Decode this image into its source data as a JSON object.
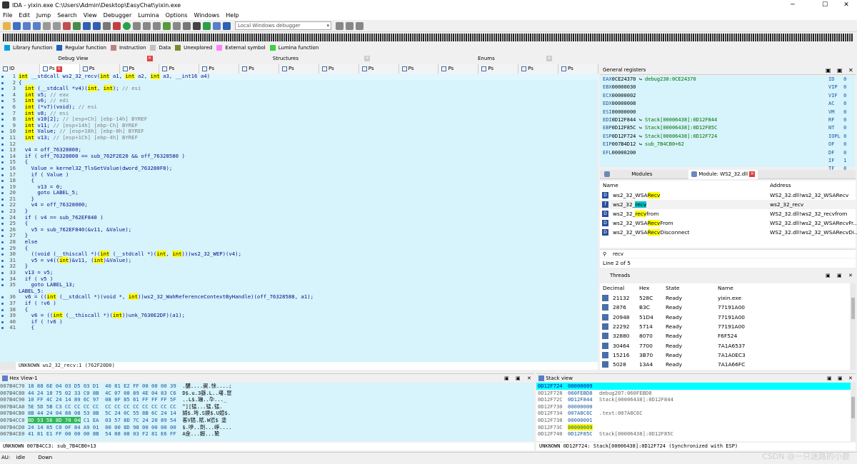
{
  "window": {
    "title": "IDA - yixin.exe C:\\Users\\Admin\\Desktop\\EasyChat\\yixin.exe"
  },
  "menu": [
    "File",
    "Edit",
    "Jump",
    "Search",
    "View",
    "Debugger",
    "Lumina",
    "Options",
    "Windows",
    "Help"
  ],
  "toolbar": {
    "debugger": "Local Windows debugger"
  },
  "legend": [
    {
      "label": "Library function",
      "color": "#00a0e0"
    },
    {
      "label": "Regular function",
      "color": "#2060c0"
    },
    {
      "label": "Instruction",
      "color": "#c08080"
    },
    {
      "label": "Data",
      "color": "#c0c0c0"
    },
    {
      "label": "Unexplored",
      "color": "#7a8a30"
    },
    {
      "label": "External symbol",
      "color": "#ff80ff"
    },
    {
      "label": "Lumina function",
      "color": "#40d040"
    }
  ],
  "top_tabs": {
    "debug_view": "Debug View",
    "structures": "Structures",
    "enums": "Enums"
  },
  "sub_tabs": {
    "first": "ID",
    "active": "Ps",
    "rest": [
      "Ps",
      "Ps",
      "Ps",
      "Ps",
      "Ps",
      "Ps",
      "Ps",
      "Ps",
      "Ps",
      "Ps",
      "Ps",
      "Ps",
      "Ps"
    ]
  },
  "pseudocode": [
    {
      "n": "1",
      "t": "int __stdcall ws2_32_recv(int a1, int a2, int a3, __int16 a4)"
    },
    {
      "n": "2",
      "t": "{"
    },
    {
      "n": "3",
      "t": "  int (__stdcall *v4)(int, int); // esi"
    },
    {
      "n": "4",
      "t": "  int v5; // eax"
    },
    {
      "n": "5",
      "t": "  int v6; // edi"
    },
    {
      "n": "6",
      "t": "  int (*v7)(void); // esi"
    },
    {
      "n": "7",
      "t": "  int v8; // esi"
    },
    {
      "n": "8",
      "t": "  int v10[2]; // [esp+Ch] [ebp-14h] BYREF"
    },
    {
      "n": "9",
      "t": "  int v11; // [esp+14h] [ebp-Ch] BYREF"
    },
    {
      "n": "10",
      "t": "  int Value; // [esp+18h] [ebp-8h] BYREF"
    },
    {
      "n": "11",
      "t": "  int v13; // [esp+1Ch] [ebp-4h] BYREF"
    },
    {
      "n": "12",
      "t": ""
    },
    {
      "n": "13",
      "t": "  v4 = off_76328000;"
    },
    {
      "n": "14",
      "t": "  if ( off_76328000 == sub_762F2E20 && off_76328580 )"
    },
    {
      "n": "15",
      "t": "  {"
    },
    {
      "n": "16",
      "t": "    Value = kernel32_TlsGetValue(dword_763280F8);"
    },
    {
      "n": "17",
      "t": "    if ( Value )"
    },
    {
      "n": "18",
      "t": "    {"
    },
    {
      "n": "19",
      "t": "      v13 = 0;"
    },
    {
      "n": "20",
      "t": "      goto LABEL_5;"
    },
    {
      "n": "21",
      "t": "    }"
    },
    {
      "n": "22",
      "t": "    v4 = off_76328000;"
    },
    {
      "n": "23",
      "t": "  }"
    },
    {
      "n": "24",
      "t": "  if ( v4 == sub_762EF840 )"
    },
    {
      "n": "25",
      "t": "  {"
    },
    {
      "n": "26",
      "t": "    v5 = sub_762EF840(&v11, &Value);"
    },
    {
      "n": "27",
      "t": "  }"
    },
    {
      "n": "28",
      "t": "  else"
    },
    {
      "n": "29",
      "t": "  {"
    },
    {
      "n": "30",
      "t": "    ((void (__thiscall *)(int (__stdcall *)(int, int)))ws2_32_WEP)(v4);"
    },
    {
      "n": "31",
      "t": "    v5 = v4((int)&v11, (int)&Value);"
    },
    {
      "n": "32",
      "t": "  }"
    },
    {
      "n": "33",
      "t": "  v13 = v5;"
    },
    {
      "n": "34",
      "t": "  if ( v5 )"
    },
    {
      "n": "35",
      "t": "    goto LABEL_13;"
    },
    {
      "n": "",
      "t": "LABEL_5:"
    },
    {
      "n": "36",
      "t": "  v6 = ((int (__stdcall *)(void *, int))ws2_32_WahReferenceContextByHandle)(off_76328588, a1);"
    },
    {
      "n": "37",
      "t": "  if ( !v6 )"
    },
    {
      "n": "38",
      "t": "  {"
    },
    {
      "n": "39",
      "t": "    v6 = ((int (__thiscall *)(int))unk_7630E2DF)(a1);"
    },
    {
      "n": "40",
      "t": "    if ( !v6 )"
    },
    {
      "n": "41",
      "t": "    {"
    }
  ],
  "pseudo_status": "UNKNOWN ws2_32_recv:1 (762F20D0)",
  "registers": {
    "title": "General registers",
    "rows": [
      {
        "r": "EAX",
        "v": "0CE24370",
        "x": "debug230:0CE24370"
      },
      {
        "r": "EBX",
        "v": "00000030",
        "x": ""
      },
      {
        "r": "ECX",
        "v": "00000002",
        "x": ""
      },
      {
        "r": "EDX",
        "v": "00000008",
        "x": ""
      },
      {
        "r": "ESI",
        "v": "00000000",
        "x": ""
      },
      {
        "r": "EDI",
        "v": "0D12F844",
        "x": "Stack[00006438]:0D12F844"
      },
      {
        "r": "EBP",
        "v": "0D12F85C",
        "x": "Stack[00006438]:0D12F85C"
      },
      {
        "r": "ESP",
        "v": "0D12F724",
        "x": "Stack[00006438]:0D12F724"
      },
      {
        "r": "EIP",
        "v": "007B4D12",
        "x": "sub_7B4CB0+62"
      },
      {
        "r": "EFL",
        "v": "00000200",
        "x": ""
      }
    ],
    "flags": [
      {
        "f": "ID",
        "v": "0"
      },
      {
        "f": "VIP",
        "v": "0"
      },
      {
        "f": "VIF",
        "v": "0"
      },
      {
        "f": "AC",
        "v": "0"
      },
      {
        "f": "VM",
        "v": "0"
      },
      {
        "f": "RF",
        "v": "0"
      },
      {
        "f": "NT",
        "v": "0"
      },
      {
        "f": "IOPL",
        "v": "0"
      },
      {
        "f": "OF",
        "v": "0"
      },
      {
        "f": "DF",
        "v": "0"
      },
      {
        "f": "IF",
        "v": "1"
      },
      {
        "f": "TF",
        "v": "0"
      },
      {
        "f": "SF",
        "v": "0"
      }
    ]
  },
  "modules": {
    "tab_modules": "Modules",
    "tab_module": "Module: WS2_32.dll",
    "col_name": "Name",
    "col_address": "Address",
    "rows": [
      {
        "pre": "ws2_32_WSA",
        "hit": "Recv",
        "post": "",
        "addr": "WS2_32.dll!ws2_32_WSARecv",
        "icon": "D"
      },
      {
        "pre": "ws2_32_",
        "hit": "recv",
        "post": "",
        "addr": "ws2_32_recv",
        "icon": "f",
        "cursor": true
      },
      {
        "pre": "ws2_32_",
        "hit": "recv",
        "post": "from",
        "addr": "WS2_32.dll!ws2_32_recvfrom",
        "icon": "D"
      },
      {
        "pre": "ws2_32_WSA",
        "hit": "Recv",
        "post": "From",
        "addr": "WS2_32.dll!ws2_32_WSARecvFr...",
        "icon": "D"
      },
      {
        "pre": "ws2_32_WSA",
        "hit": "Recv",
        "post": "Disconnect",
        "addr": "WS2_32.dll!ws2_32_WSARecvDi...",
        "icon": "D"
      }
    ],
    "search": "recv",
    "status": "Line 2 of 5"
  },
  "threads": {
    "title": "Threads",
    "cols": [
      "Decimal",
      "Hex",
      "State",
      "Name"
    ],
    "rows": [
      [
        "21132",
        "528C",
        "Ready",
        "yixin.exe"
      ],
      [
        "2876",
        "B3C",
        "Ready",
        "77191A00"
      ],
      [
        "20948",
        "51D4",
        "Ready",
        "77191A00"
      ],
      [
        "22292",
        "5714",
        "Ready",
        "77191A00"
      ],
      [
        "32880",
        "8070",
        "Ready",
        "F6F524"
      ],
      [
        "30464",
        "7700",
        "Ready",
        "7A1A6537"
      ],
      [
        "15216",
        "3B70",
        "Ready",
        "7A1A0EC3"
      ],
      [
        "5028",
        "13A4",
        "Ready",
        "7A1A66FC"
      ]
    ]
  },
  "hex": {
    "title": "Hex View-1",
    "rows": [
      {
        "a": "007B4C70",
        "b": "18 88 6E 04 03 D5 03 D1  40 81 E2 FF 00 00 00 39",
        "s": ".醲....翜.悇....;"
      },
      {
        "a": "007B4C80",
        "b": "44 24 18 75 02 33 C0 8B  4C 07 08 89 4E 04 83 C6",
        "s": "D$.u.3繇.L..墸.冟"
      },
      {
        "a": "007B4C90",
        "b": "10 FF 4C 24 14 89 6C 97  08 0F 85 61 FF FF FF 5F",
        "s": "..L$.塴..卆..._"
      },
      {
        "a": "007B4CA0",
        "b": "5E 5D 5B C3 CC CC CC CC  CC CC CC CC CC CC CC CC",
        "s": "^][锰...锰.锰."
      },
      {
        "a": "007B4CB0",
        "b": "8B 44 24 04 88 08 53 8B  5C 24 0C 55 8B 6C 24 14",
        "s": "婦$.埓.S媆$.U媗$."
      },
      {
        "a": "007B4CC0",
        "b": "8D 53 56 8D 70 04 C1 EA  03 57 8D 7C 24 20 89 54",
        "s": "峉V峱.陚.W峾$ 塗",
        "sel": true
      },
      {
        "a": "007B4CD0",
        "b": "24 14 85 C0 0F 84 A9 01  00 00 8D 98 00 00 00 00",
        "s": "$.吚..劑...崢...."
      },
      {
        "a": "007B4CE0",
        "b": "41 81 E1 FF 00 00 00 8B  54 88 08 03 F2 81 E6 FF",
        "s": "A佱...婽...騺"
      }
    ],
    "status": "UNKNOWN 007B4CC3: sub_7B4CB0+13"
  },
  "stack": {
    "title": "Stack view",
    "rows": [
      {
        "a": "0D12F724",
        "v": "00000009",
        "c": "",
        "cur": true
      },
      {
        "a": "0D12F728",
        "v": "060FEBD8",
        "c": "debug207:060FEBD8"
      },
      {
        "a": "0D12F72C",
        "v": "0D12F844",
        "c": "Stack[00006438]:0D12F844"
      },
      {
        "a": "0D12F730",
        "v": "00000000",
        "c": ""
      },
      {
        "a": "0D12F734",
        "v": "007A8C6C",
        "c": ".text:007A8C6C"
      },
      {
        "a": "0D12F738",
        "v": "00000001",
        "c": ""
      },
      {
        "a": "0D12F73C",
        "v": "00000009",
        "c": "",
        "vhl": true
      },
      {
        "a": "0D12F740",
        "v": "0D12F85C",
        "c": "Stack[00006438]:0D12F85C"
      }
    ],
    "status": "UNKNOWN 0D12F724: Stack[00006438]:0D12F724 (Synchronized with ESP)"
  },
  "statusbar": {
    "au": "AU:",
    "state": "idle",
    "dir": "Down"
  },
  "watermark": "CSDN @一只迷路的小鹿"
}
